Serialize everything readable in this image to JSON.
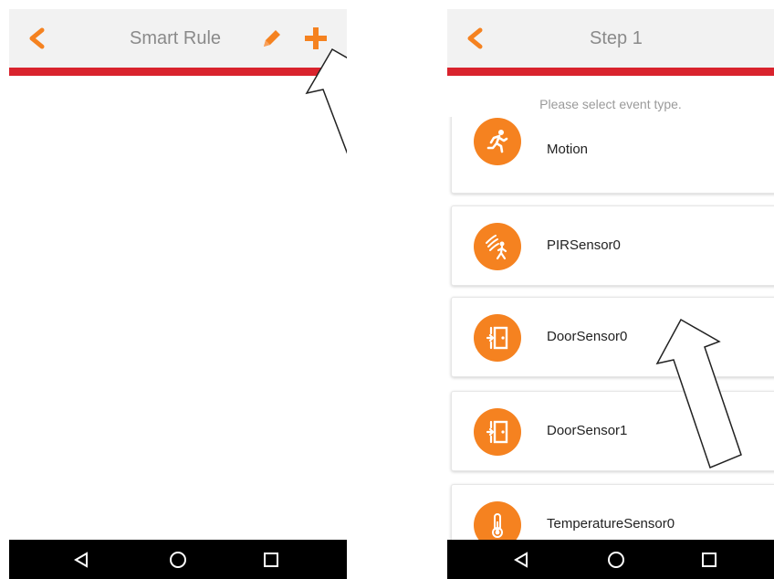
{
  "colors": {
    "accent_orange": "#f58220",
    "red_line": "#d9232d",
    "appbar_bg": "#f2f2f2",
    "title_gray": "#8a8a8a",
    "navbar_bg": "#000000"
  },
  "left_screen": {
    "title": "Smart Rule",
    "icons": [
      "back-chevron-icon",
      "pencil-icon",
      "plus-icon"
    ],
    "nav": [
      "back-triangle-icon",
      "home-circle-icon",
      "recents-square-icon"
    ]
  },
  "right_screen": {
    "title": "Step 1",
    "prompt": "Please select event type.",
    "events": [
      {
        "label": "Motion",
        "icon": "running-person-icon"
      },
      {
        "label": "PIRSensor0",
        "icon": "pir-sensor-icon"
      },
      {
        "label": "DoorSensor0",
        "icon": "door-icon"
      },
      {
        "label": "DoorSensor1",
        "icon": "door-icon"
      },
      {
        "label": "TemperatureSensor0",
        "icon": "thermometer-icon"
      }
    ],
    "nav": [
      "back-triangle-icon",
      "home-circle-icon",
      "recents-square-icon"
    ]
  }
}
